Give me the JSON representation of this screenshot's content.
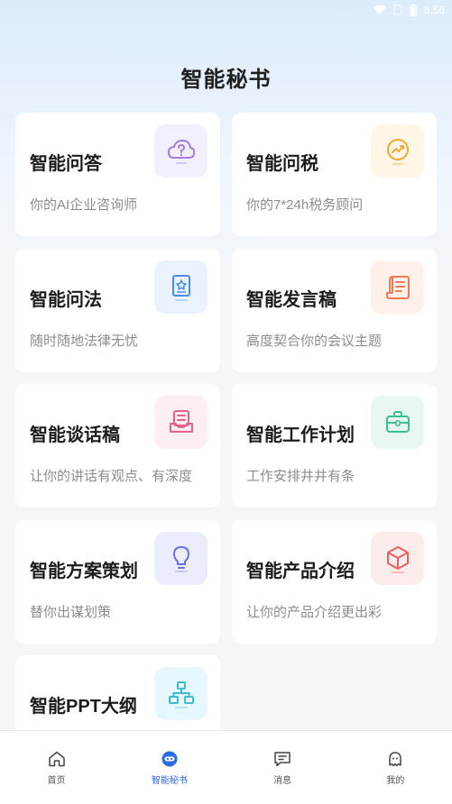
{
  "status": {
    "time": "8:56"
  },
  "page": {
    "title": "智能秘书"
  },
  "cards": [
    {
      "title": "智能问答",
      "subtitle": "你的AI企业咨询师",
      "icon": "cloud-question-icon"
    },
    {
      "title": "智能问税",
      "subtitle": "你的7*24h税务顾问",
      "icon": "chart-circle-icon"
    },
    {
      "title": "智能问法",
      "subtitle": "随时随地法律无忧",
      "icon": "law-book-icon"
    },
    {
      "title": "智能发言稿",
      "subtitle": "高度契合你的会议主题",
      "icon": "scroll-icon"
    },
    {
      "title": "智能谈话稿",
      "subtitle": "让你的讲话有观点、有深度",
      "icon": "inbox-doc-icon"
    },
    {
      "title": "智能工作计划",
      "subtitle": "工作安排井井有条",
      "icon": "briefcase-icon"
    },
    {
      "title": "智能方案策划",
      "subtitle": "替你出谋划策",
      "icon": "lightbulb-icon"
    },
    {
      "title": "智能产品介绍",
      "subtitle": "让你的产品介绍更出彩",
      "icon": "cube-icon"
    },
    {
      "title": "智能PPT大纲",
      "subtitle": "",
      "icon": "org-chart-icon"
    }
  ],
  "tabs": [
    {
      "label": "首页",
      "icon": "home-icon",
      "active": false
    },
    {
      "label": "智能秘书",
      "icon": "robot-icon",
      "active": true
    },
    {
      "label": "消息",
      "icon": "message-icon",
      "active": false
    },
    {
      "label": "我的",
      "icon": "profile-icon",
      "active": false
    }
  ],
  "colors": {
    "accent": "#2b6be6",
    "icon_purple": "#a07ee0",
    "icon_orange": "#f0a830",
    "icon_blue": "#4a8de8",
    "icon_coral": "#f07a55",
    "icon_pink": "#e8608a",
    "icon_green": "#3cc08a",
    "icon_indigo": "#6a6ee0",
    "icon_red": "#e86060",
    "icon_teal": "#3cbcd0"
  }
}
